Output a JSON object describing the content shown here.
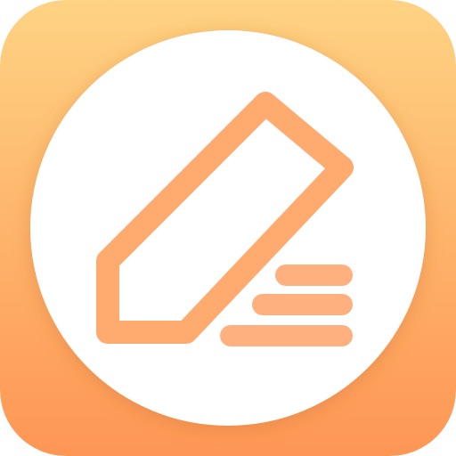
{
  "app_icon": {
    "icon_name": "pencil-notes-icon",
    "colors": {
      "background_top": "#fed383",
      "background_bottom": "#fe9655",
      "circle": "#ffffff",
      "pencil_top": "#fde46e",
      "pencil_bottom": "#ffaa6f",
      "lines": "#ffb07e"
    }
  }
}
